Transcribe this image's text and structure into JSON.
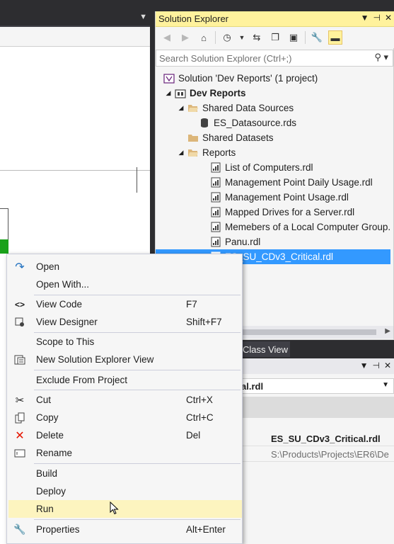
{
  "solution_explorer": {
    "title": "Solution Explorer",
    "search_placeholder": "Search Solution Explorer (Ctrl+;)",
    "tree": {
      "solution": "Solution 'Dev Reports' (1 project)",
      "project": "Dev Reports",
      "shared_data_sources": "Shared Data Sources",
      "datasource": "ES_Datasource.rds",
      "shared_datasets": "Shared Datasets",
      "reports_folder": "Reports",
      "reports": [
        "List of Computers.rdl",
        "Management Point Daily Usage.rdl",
        "Management Point Usage.rdl",
        "Mapped Drives for a Server.rdl",
        "Memebers of a Local Computer Group.",
        "Panu.rdl",
        "ES_SU_CDv3_Critical.rdl"
      ]
    }
  },
  "class_view_tab": "Class View",
  "properties": {
    "object_name": "al.rdl",
    "rows": [
      {
        "value": "ES_SU_CDv3_Critical.rdl"
      },
      {
        "value": "S:\\Products\\Projects\\ER6\\De"
      }
    ]
  },
  "context_menu": {
    "items": [
      {
        "label": "Open",
        "key": "",
        "icon": "open-arrow-icon"
      },
      {
        "label": "Open With...",
        "key": "",
        "icon": ""
      },
      {
        "label": "View Code",
        "key": "F7",
        "icon": "code-icon"
      },
      {
        "label": "View Designer",
        "key": "Shift+F7",
        "icon": "designer-icon"
      },
      {
        "label": "Scope to This",
        "key": "",
        "icon": ""
      },
      {
        "label": "New Solution Explorer View",
        "key": "",
        "icon": "new-view-icon"
      },
      {
        "label": "Exclude From Project",
        "key": "",
        "icon": ""
      },
      {
        "label": "Cut",
        "key": "Ctrl+X",
        "icon": "scissors-icon"
      },
      {
        "label": "Copy",
        "key": "Ctrl+C",
        "icon": "copy-icon"
      },
      {
        "label": "Delete",
        "key": "Del",
        "icon": "delete-x-icon"
      },
      {
        "label": "Rename",
        "key": "",
        "icon": "rename-icon"
      },
      {
        "label": "Build",
        "key": "",
        "icon": ""
      },
      {
        "label": "Deploy",
        "key": "",
        "icon": ""
      },
      {
        "label": "Run",
        "key": "",
        "icon": ""
      },
      {
        "label": "Properties",
        "key": "Alt+Enter",
        "icon": "wrench-icon"
      }
    ]
  },
  "colors": {
    "active_title": "#fff29d",
    "selection": "#3399ff",
    "menu_hover": "#fdf4bf",
    "delete_red": "#e51400"
  }
}
